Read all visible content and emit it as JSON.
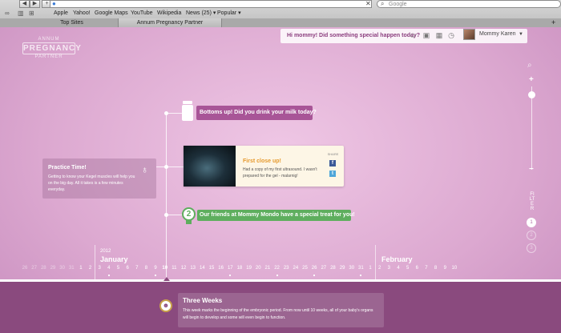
{
  "browser": {
    "search_placeholder": "Google",
    "bookmarks": [
      "Apple",
      "Yahoo!",
      "Google Maps",
      "YouTube",
      "Wikipedia",
      "News (25) ▾",
      "Popular ▾"
    ],
    "tabs": [
      "Top Sites",
      "Annum Pregnancy Partner"
    ]
  },
  "logo": {
    "line1": "ANNUM",
    "line2": "PREGNANCY",
    "line3": "PARTNER"
  },
  "topbar": {
    "greeting": "Hi mommy!  Did something special happen today?",
    "user_name": "Mommy Karen"
  },
  "filter": {
    "label": "FILTER",
    "buttons": [
      "1",
      "2",
      "3"
    ]
  },
  "events": {
    "milk": "Bottoms up! Did you drink your milk today?",
    "ultrasound": {
      "title": "First close up!",
      "text": "Had a copy of my first ultrasound. I wasn't prepared for the gel - malarnig!",
      "share_label": "SHARE"
    },
    "practice": {
      "title": "Practice Time!",
      "text": "Getting to know your Kegel muscles will help you on the big day. All it takes is a few minutes everyday."
    },
    "treat": {
      "badge": "2",
      "text": "Our friends at Mommy Mondo have a special treat for you!"
    }
  },
  "axis": {
    "year": "2012",
    "months": [
      "January",
      "February"
    ],
    "days_prev": [
      "26",
      "27",
      "28",
      "29",
      "30",
      "31"
    ],
    "days_jan": [
      "1",
      "2",
      "3",
      "4",
      "5",
      "6",
      "7",
      "8",
      "9",
      "10",
      "11",
      "12",
      "13",
      "14",
      "15",
      "16",
      "17",
      "18",
      "19",
      "20",
      "21",
      "22",
      "23",
      "24",
      "25",
      "26",
      "27",
      "28",
      "29",
      "30",
      "31"
    ],
    "days_feb": [
      "1",
      "2",
      "3",
      "4",
      "5",
      "6",
      "7",
      "8",
      "9",
      "10"
    ]
  },
  "week": {
    "title": "Three Weeks",
    "text": "This week marks the beginning of the embryonic period. From now until 10 weeks, all of your baby's organs will begin to develop and some will even begin to function."
  }
}
